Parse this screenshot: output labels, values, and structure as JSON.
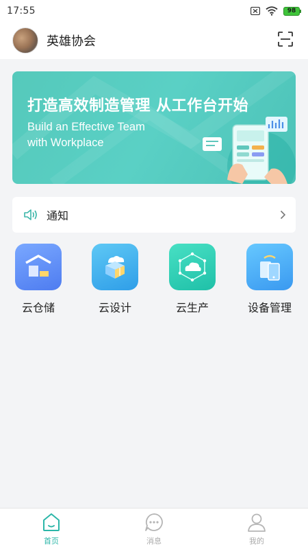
{
  "status_bar": {
    "time": "17:55",
    "battery": "98"
  },
  "header": {
    "title": "英雄协会"
  },
  "banner": {
    "title": "打造高效制造管理 从工作台开始",
    "subtitle_line1": "Build an Effective Team",
    "subtitle_line2": "with Workplace"
  },
  "notice": {
    "label": "通知"
  },
  "apps": [
    {
      "label": "云仓储",
      "icon": "warehouse-icon"
    },
    {
      "label": "云设计",
      "icon": "cloud-design-icon"
    },
    {
      "label": "云生产",
      "icon": "cloud-production-icon"
    },
    {
      "label": "设备管理",
      "icon": "device-management-icon"
    }
  ],
  "tabs": [
    {
      "label": "首页",
      "icon": "home-icon",
      "active": true
    },
    {
      "label": "消息",
      "icon": "message-icon",
      "active": false
    },
    {
      "label": "我的",
      "icon": "profile-icon",
      "active": false
    }
  ],
  "colors": {
    "accent": "#2bb6a8",
    "banner": "#55c9bb"
  }
}
